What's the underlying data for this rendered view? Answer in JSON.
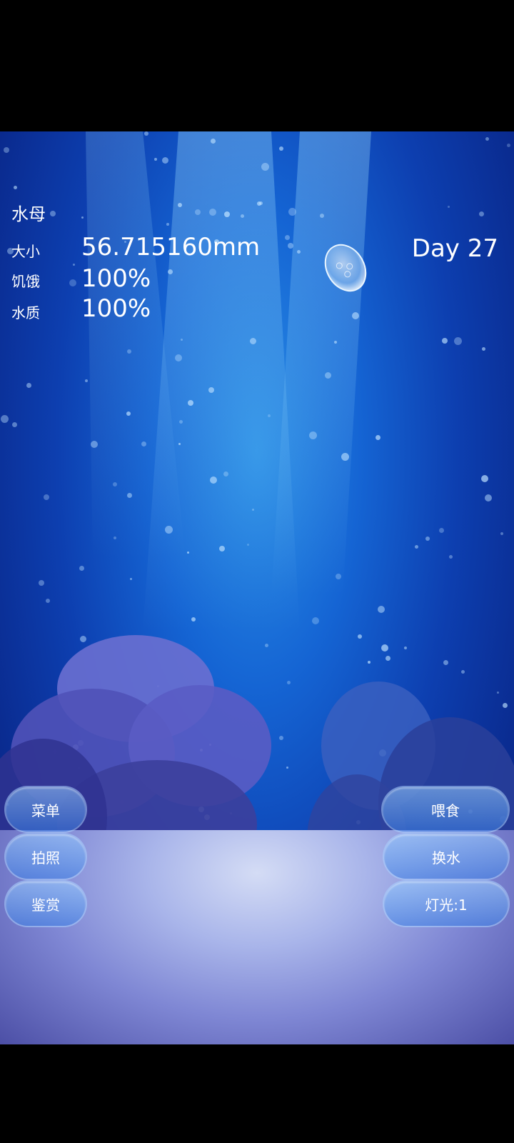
{
  "stats": {
    "title": "水母",
    "size_label": "大小",
    "size_value": "56.715160mm",
    "hunger_label": "饥饿",
    "hunger_value": "100%",
    "water_label": "水质",
    "water_value": "100%"
  },
  "day": "Day 27",
  "buttons": {
    "menu": "菜单",
    "photo": "拍照",
    "appreciate": "鉴赏",
    "feed": "喂食",
    "change_water": "换水",
    "light": "灯光:1"
  },
  "icons": {
    "jellyfish": "jellyfish-icon"
  }
}
